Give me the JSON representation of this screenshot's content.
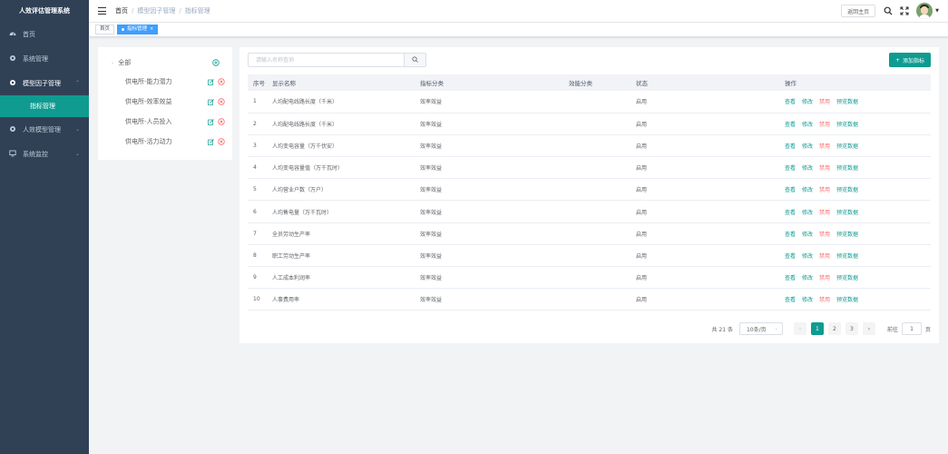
{
  "app": {
    "title": "人效评估管理系统"
  },
  "sidebar": {
    "items": [
      {
        "label": "首页",
        "icon": "dashboard-icon"
      },
      {
        "label": "系统管理",
        "icon": "gear-icon"
      },
      {
        "label": "模型因子管理",
        "icon": "gear-icon",
        "open": true,
        "children": [
          {
            "label": "指标管理",
            "active": true
          }
        ]
      },
      {
        "label": "人效模型管理",
        "icon": "gear-icon"
      },
      {
        "label": "系统监控",
        "icon": "monitor-icon"
      }
    ]
  },
  "header": {
    "breadcrumb": [
      "首页",
      "模型因子管理",
      "指标管理"
    ],
    "home_button": "返回主页"
  },
  "tags": [
    {
      "label": "首页",
      "active": false
    },
    {
      "label": "指标管理",
      "active": true
    }
  ],
  "tree": {
    "root": "全部",
    "nodes": [
      "供电所-能力潜力",
      "供电所-效率效益",
      "供电所-人员投入",
      "供电所-活力动力"
    ]
  },
  "search": {
    "placeholder": "请输入名称查询"
  },
  "add_button": "添加指标",
  "table": {
    "columns": [
      "序号",
      "显示名称",
      "指标分类",
      "效能分类",
      "状态",
      "操作"
    ],
    "rows": [
      [
        "1",
        "人均配电线路长度（千米）",
        "效率效益",
        "",
        "启用"
      ],
      [
        "2",
        "人均配电线路长度（千米）",
        "效率效益",
        "",
        "启用"
      ],
      [
        "3",
        "人均变电容量（万千伏安）",
        "效率效益",
        "",
        "启用"
      ],
      [
        "4",
        "人均变电容量值（万千瓦时）",
        "效率效益",
        "",
        "启用"
      ],
      [
        "5",
        "人均营业户数（万户）",
        "效率效益",
        "",
        "启用"
      ],
      [
        "6",
        "人均售电量（万千瓦时）",
        "效率效益",
        "",
        "启用"
      ],
      [
        "7",
        "全员劳动生产率",
        "效率效益",
        "",
        "启用"
      ],
      [
        "8",
        "职工劳动生产率",
        "效率效益",
        "",
        "启用"
      ],
      [
        "9",
        "人工成本利润率",
        "效率效益",
        "",
        "启用"
      ],
      [
        "10",
        "人事费用率",
        "效率效益",
        "",
        "启用"
      ]
    ],
    "actions": [
      "查看",
      "修改",
      "禁用",
      "预览数据"
    ]
  },
  "pagination": {
    "total_text": "共 21 条",
    "page_size": "10条/页",
    "pages": [
      "1",
      "2",
      "3"
    ],
    "current": "1",
    "goto_label": "前往",
    "goto_value": "1",
    "page_suffix": "页"
  },
  "colors": {
    "sidebar_bg": "#304156",
    "accent": "#0f9b90",
    "danger": "#ff6b6b",
    "tag_active": "#409eff"
  }
}
